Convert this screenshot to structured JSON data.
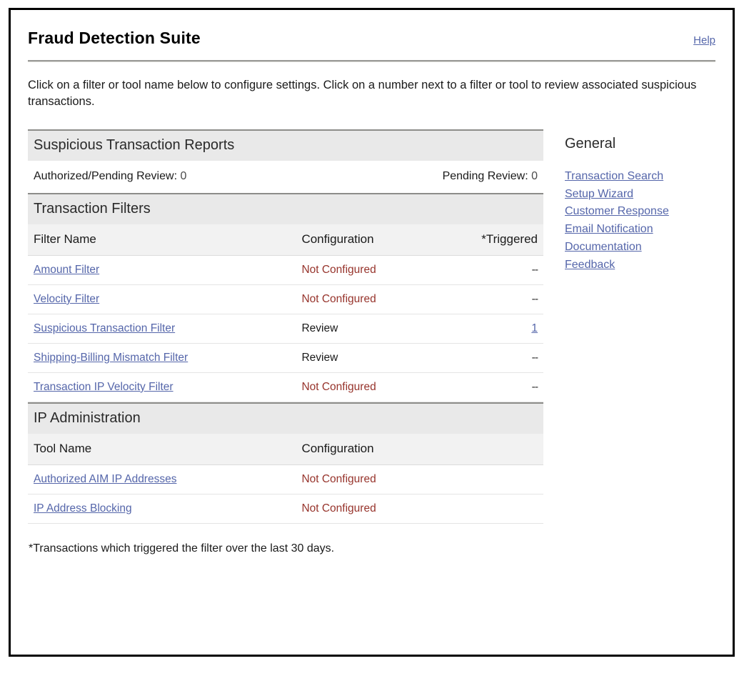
{
  "header": {
    "title": "Fraud Detection Suite",
    "help_label": "Help"
  },
  "intro": {
    "text": "Click on a filter or tool name below to configure settings. Click on a number next to a filter or tool to review associated suspicious transactions."
  },
  "reports": {
    "section_title": "Suspicious Transaction Reports",
    "authorized_pending_label": "Authorized/Pending Review:",
    "authorized_pending_value": "0",
    "pending_label": "Pending Review:",
    "pending_value": "0"
  },
  "filters": {
    "section_title": "Transaction Filters",
    "columns": {
      "name": "Filter Name",
      "configuration": "Configuration",
      "triggered": "*Triggered"
    },
    "rows": [
      {
        "name": "Amount Filter",
        "configuration": "Not Configured",
        "config_state": "not",
        "triggered": "--",
        "triggered_is_link": false
      },
      {
        "name": "Velocity Filter",
        "configuration": "Not Configured",
        "config_state": "not",
        "triggered": "--",
        "triggered_is_link": false
      },
      {
        "name": "Suspicious Transaction Filter",
        "configuration": "Review",
        "config_state": "review",
        "triggered": "1",
        "triggered_is_link": true
      },
      {
        "name": "Shipping-Billing Mismatch Filter",
        "configuration": "Review",
        "config_state": "review",
        "triggered": "--",
        "triggered_is_link": false
      },
      {
        "name": "Transaction IP Velocity Filter",
        "configuration": "Not Configured",
        "config_state": "not",
        "triggered": "--",
        "triggered_is_link": false
      }
    ]
  },
  "ip_admin": {
    "section_title": "IP Administration",
    "columns": {
      "name": "Tool Name",
      "configuration": "Configuration"
    },
    "rows": [
      {
        "name": "Authorized AIM IP Addresses",
        "configuration": "Not Configured",
        "config_state": "not"
      },
      {
        "name": "IP Address Blocking",
        "configuration": "Not Configured",
        "config_state": "not"
      }
    ]
  },
  "footnote": {
    "text": "*Transactions which triggered the filter over the last 30 days."
  },
  "sidebar": {
    "title": "General",
    "links": [
      "Transaction Search",
      "Setup Wizard",
      "Customer Response",
      "Email Notification",
      "Documentation",
      "Feedback"
    ]
  },
  "colors": {
    "link": "#5566aa",
    "not_configured": "#97342c",
    "section_bar": "#e9e9e9",
    "column_header": "#f2f2f2",
    "rule": "#8d8d8a"
  }
}
